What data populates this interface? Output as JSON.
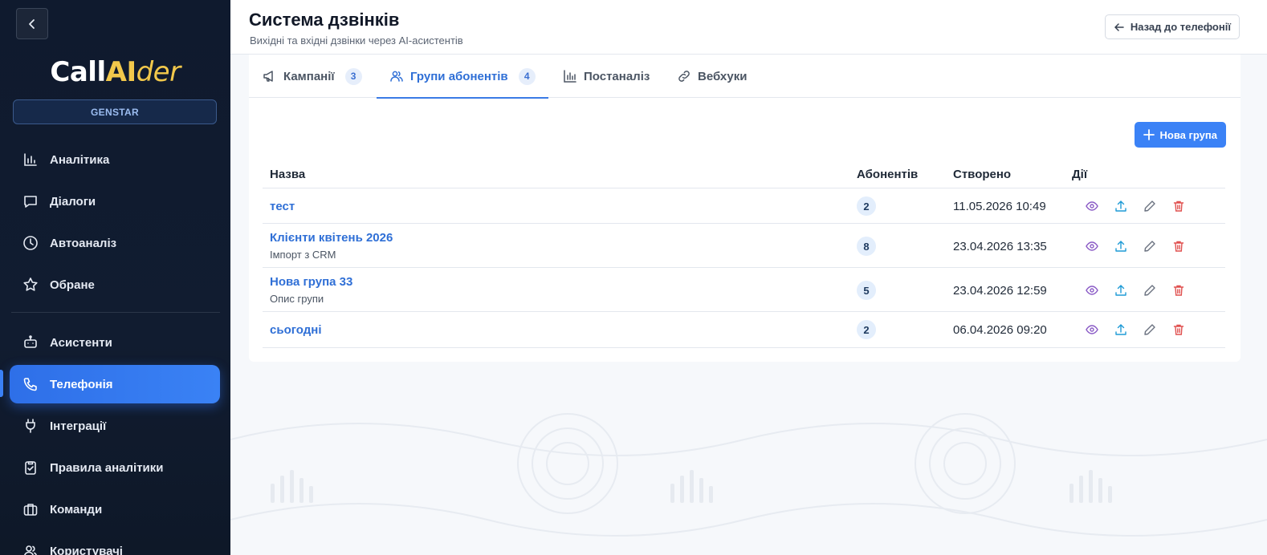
{
  "sidebar": {
    "logo": {
      "part1": "Call",
      "part2": "AI",
      "part3": "der"
    },
    "org": "GENSTAR",
    "items": [
      {
        "label": "Аналітика",
        "icon": "chart-bar-icon"
      },
      {
        "label": "Діалоги",
        "icon": "chat-bubble-icon"
      },
      {
        "label": "Автоаналіз",
        "icon": "clock-icon"
      },
      {
        "label": "Обране",
        "icon": "star-icon"
      },
      {
        "label": "Асистенти",
        "icon": "robot-icon"
      },
      {
        "label": "Телефонія",
        "icon": "phone-icon",
        "active": true
      },
      {
        "label": "Інтеграції",
        "icon": "plug-icon"
      },
      {
        "label": "Правила аналітики",
        "icon": "clipboard-check-icon"
      },
      {
        "label": "Команди",
        "icon": "briefcase-icon"
      },
      {
        "label": "Користувачі",
        "icon": "users-icon"
      }
    ]
  },
  "header": {
    "title": "Система дзвінків",
    "subtitle": "Вихідні та вхідні дзвінки через AI-асистентів",
    "back_label": "Назад до телефонії"
  },
  "tabs": [
    {
      "label": "Кампанії",
      "count": "3",
      "icon": "megaphone-icon"
    },
    {
      "label": "Групи абонентів",
      "count": "4",
      "icon": "users-icon",
      "active": true
    },
    {
      "label": "Постаналіз",
      "count": "",
      "icon": "bar-chart-icon"
    },
    {
      "label": "Вебхуки",
      "count": "",
      "icon": "link-icon"
    }
  ],
  "new_group_label": "Нова група",
  "table": {
    "columns": {
      "name": "Назва",
      "subscribers": "Абонентів",
      "created": "Створено",
      "actions": "Дії"
    },
    "rows": [
      {
        "name": "тест",
        "desc": "",
        "count": "2",
        "created": "11.05.2026 10:49"
      },
      {
        "name": "Клієнти квітень 2026",
        "desc": "Імпорт з CRM",
        "count": "8",
        "created": "23.04.2026 13:35"
      },
      {
        "name": "Нова група 33",
        "desc": "Опис групи",
        "count": "5",
        "created": "23.04.2026 12:59"
      },
      {
        "name": "сьогодні",
        "desc": "",
        "count": "2",
        "created": "06.04.2026 09:20"
      }
    ]
  },
  "colors": {
    "accent": "#3b82f6",
    "sidebar_bg": "#0f1a2e",
    "view_icon": "#8b5cc6",
    "upload_icon": "#1f9bd6",
    "edit_icon": "#6b7280",
    "delete_icon": "#e0504f"
  }
}
